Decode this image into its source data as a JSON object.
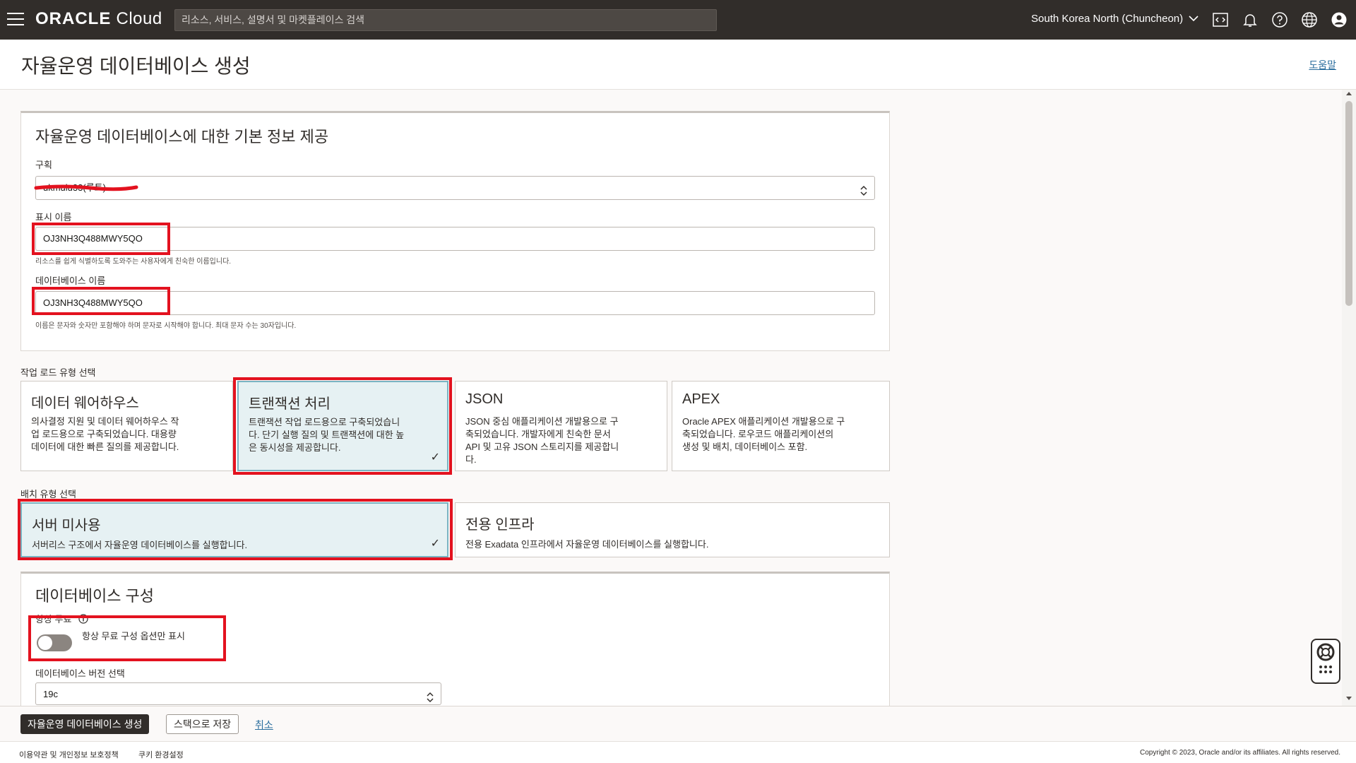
{
  "header": {
    "logo_bold": "ORACLE",
    "logo_light": " Cloud",
    "search_placeholder": "리소스, 서비스, 설명서 및 마켓플레이스 검색",
    "region": "South Korea North (Chuncheon)",
    "icons": [
      "menu-icon",
      "code-editor-icon",
      "bell-icon",
      "help-icon",
      "globe-icon",
      "user-icon"
    ]
  },
  "page": {
    "title": "자율운영 데이터베이스 생성",
    "help_link": "도움말"
  },
  "basic_info": {
    "section_title": "자율운영 데이터베이스에 대한 기본 정보 제공",
    "compartment_label": "구획",
    "compartment_value": "ukmulu33(루트)",
    "display_name_label": "표시 이름",
    "display_name_value": "OJ3NH3Q488MWY5QO",
    "display_name_help": "리소스를 쉽게 식별하도록 도와주는 사용자에게 친숙한 이름입니다.",
    "db_name_label": "데이터베이스 이름",
    "db_name_value": "OJ3NH3Q488MWY5QO",
    "db_name_help": "이름은 문자와 숫자만 포함해야 하며 문자로 시작해야 합니다. 최대 문자 수는 30자입니다."
  },
  "workload": {
    "label": "작업 로드 유형 선택",
    "options": [
      {
        "title": "데이터 웨어하우스",
        "desc": [
          "의사결정 지원 및 데이터 웨어하우스 작",
          "업 로드용으로 구축되었습니다. 대용량",
          "데이터에 대한 빠른 질의를 제공합니다."
        ],
        "selected": false
      },
      {
        "title": "트랜잭션 처리",
        "desc": [
          "트랜잭션 작업 로드용으로 구축되었습니",
          "다. 단기 실행 질의 및 트랜잭션에 대한 높",
          "은 동시성을 제공합니다."
        ],
        "selected": true
      },
      {
        "title": "JSON",
        "desc": [
          "JSON 중심 애플리케이션 개발용으로 구",
          "축되었습니다. 개발자에게 친숙한 문서",
          "API 및 고유 JSON 스토리지를 제공합니",
          "다."
        ],
        "selected": false
      },
      {
        "title": "APEX",
        "desc": [
          "Oracle APEX 애플리케이션 개발용으로 구",
          "축되었습니다. 로우코드 애플리케이션의",
          "생성 및 배치, 데이터베이스 포함."
        ],
        "selected": false
      }
    ]
  },
  "deployment": {
    "label": "배치 유형 선택",
    "options": [
      {
        "title": "서버 미사용",
        "desc": "서버리스 구조에서 자율운영 데이터베이스를 실행합니다.",
        "selected": true
      },
      {
        "title": "전용 인프라",
        "desc": "전용 Exadata 인프라에서 자율운영 데이터베이스를 실행합니다.",
        "selected": false
      }
    ]
  },
  "db_config": {
    "section_title": "데이터베이스 구성",
    "always_free_label": "항상 무료",
    "always_free_toggle_text": "항상 무료 구성 옵션만 표시",
    "always_free_on": false,
    "version_label": "데이터베이스 버전 선택",
    "version_value": "19c"
  },
  "actions": {
    "create": "자율운영 데이터베이스 생성",
    "save_stack": "스택으로 저장",
    "cancel": "취소"
  },
  "footer": {
    "terms": "이용약관 및 개인정보 보호정책",
    "cookies": "쿠키 환경설정",
    "copyright": "Copyright © 2023, Oracle and/or its affiliates. All rights reserved."
  },
  "colors": {
    "header_bg": "#312d2a",
    "highlight_red": "#e3121f",
    "selected_tile_bg": "#e6f1f3",
    "link": "#2b6e9e"
  }
}
